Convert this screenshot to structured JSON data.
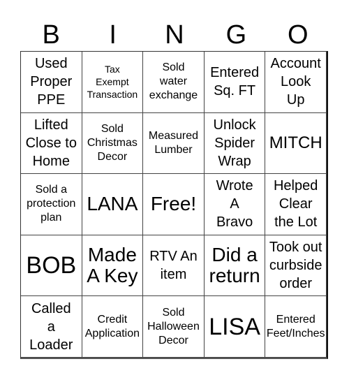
{
  "header": {
    "letters": [
      "B",
      "I",
      "N",
      "G",
      "O"
    ]
  },
  "board": {
    "rows": [
      [
        {
          "text": "Used\nProper\nPPE",
          "size": "md"
        },
        {
          "text": "Tax\nExempt\nTransaction",
          "size": "xs"
        },
        {
          "text": "Sold\nwater\nexchange",
          "size": "sm"
        },
        {
          "text": "Entered\nSq. FT",
          "size": "md"
        },
        {
          "text": "Account\nLook\nUp",
          "size": "md"
        }
      ],
      [
        {
          "text": "Lifted\nClose to\nHome",
          "size": "md"
        },
        {
          "text": "Sold\nChristmas\nDecor",
          "size": "sm"
        },
        {
          "text": "Measured\nLumber",
          "size": "sm"
        },
        {
          "text": "Unlock\nSpider\nWrap",
          "size": "md"
        },
        {
          "text": "MITCH",
          "size": "lg"
        }
      ],
      [
        {
          "text": "Sold a\nprotection\nplan",
          "size": "sm"
        },
        {
          "text": "LANA",
          "size": "xl"
        },
        {
          "text": "Free!",
          "size": "xl"
        },
        {
          "text": "Wrote\nA\nBravo",
          "size": "md"
        },
        {
          "text": "Helped\nClear\nthe Lot",
          "size": "md"
        }
      ],
      [
        {
          "text": "BOB",
          "size": "xxl"
        },
        {
          "text": "Made\nA Key",
          "size": "xl"
        },
        {
          "text": "RTV An\nitem",
          "size": "md"
        },
        {
          "text": "Did a\nreturn",
          "size": "xl"
        },
        {
          "text": "Took out\ncurbside\norder",
          "size": "md"
        }
      ],
      [
        {
          "text": "Called\na\nLoader",
          "size": "md"
        },
        {
          "text": "Credit\nApplication",
          "size": "sm"
        },
        {
          "text": "Sold\nHalloween\nDecor",
          "size": "sm"
        },
        {
          "text": "LISA",
          "size": "xxl"
        },
        {
          "text": "Entered\nFeet/Inches",
          "size": "sm"
        }
      ]
    ]
  }
}
